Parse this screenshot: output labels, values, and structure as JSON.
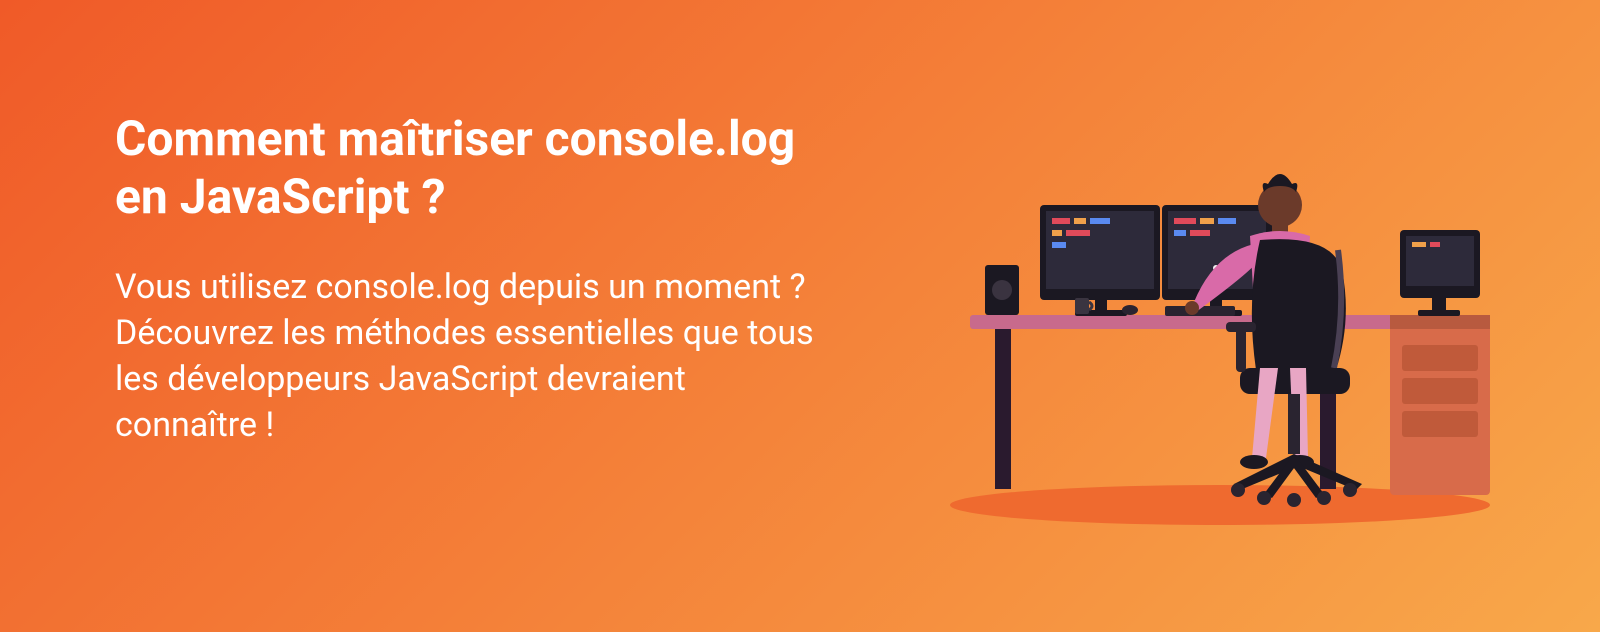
{
  "hero": {
    "title": "Comment maîtriser console.log en JavaScript ?",
    "subtitle": "Vous utilisez console.log depuis un moment ?\nDécouvrez les méthodes essentielles que tous les développeurs JavaScript devraient connaître !"
  },
  "illustration": {
    "name": "developer-at-desk-icon"
  }
}
